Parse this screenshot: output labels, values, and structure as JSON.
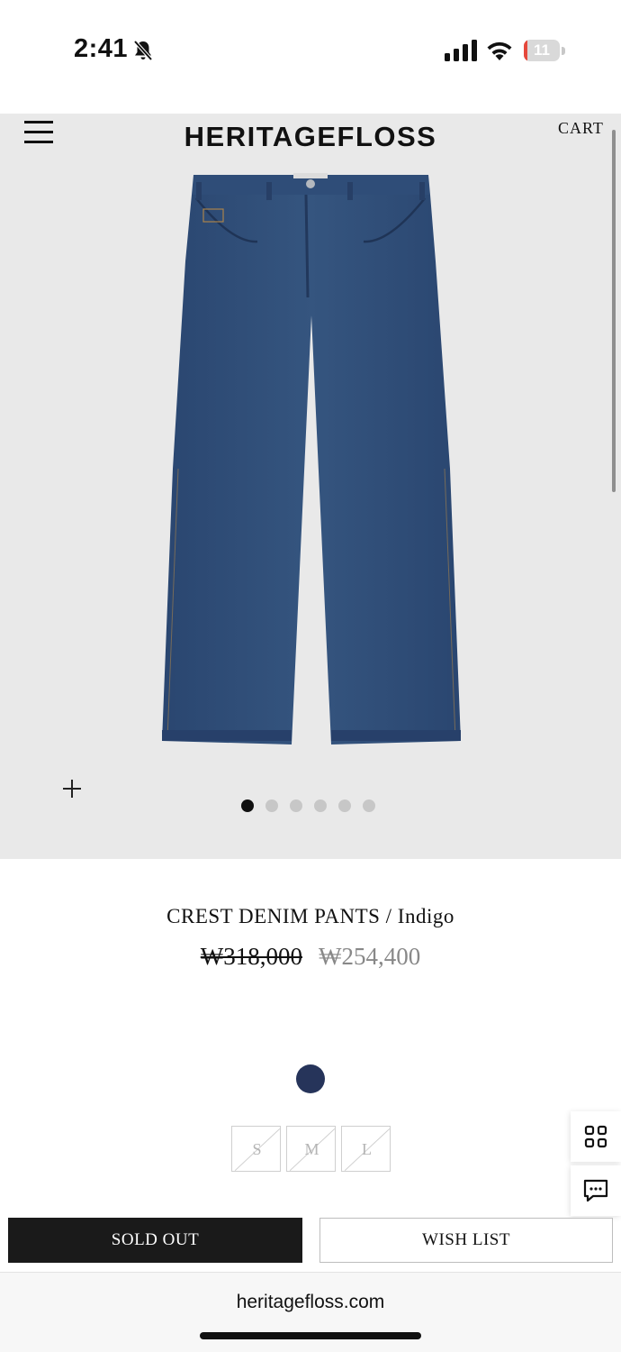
{
  "status_bar": {
    "time": "2:41",
    "battery_level": "11",
    "battery_fraction": 0.11,
    "icons": [
      "bell-slash-icon",
      "cellular-signal-icon",
      "wifi-icon",
      "battery-icon"
    ]
  },
  "header": {
    "brand": "HERITAGEFLOSS",
    "cart_label": "CART",
    "menu_icon": "hamburger-menu-icon"
  },
  "gallery": {
    "image_subject": "indigo denim pants",
    "total_images": 6,
    "active_index": 0,
    "zoom_icon": "plus-icon"
  },
  "product": {
    "title": "CREST DENIM PANTS / Indigo",
    "original_price": "₩318,000",
    "sale_price": "₩254,400",
    "swatch_color": "#26345a",
    "sizes": [
      "S",
      "M",
      "L"
    ]
  },
  "floating_buttons": {
    "grid_icon": "grid-icon",
    "chat_icon": "chat-bubble-icon"
  },
  "actions": {
    "sold_out_label": "SOLD OUT",
    "wish_list_label": "WISH LIST"
  },
  "browser": {
    "url": "heritagefloss.com"
  },
  "colors": {
    "hero_background": "#e9e9e9",
    "button_dark": "#1a1a1a",
    "sale_price": "#888888",
    "denim": "#2d4a73",
    "battery_low": "#e5483b"
  }
}
